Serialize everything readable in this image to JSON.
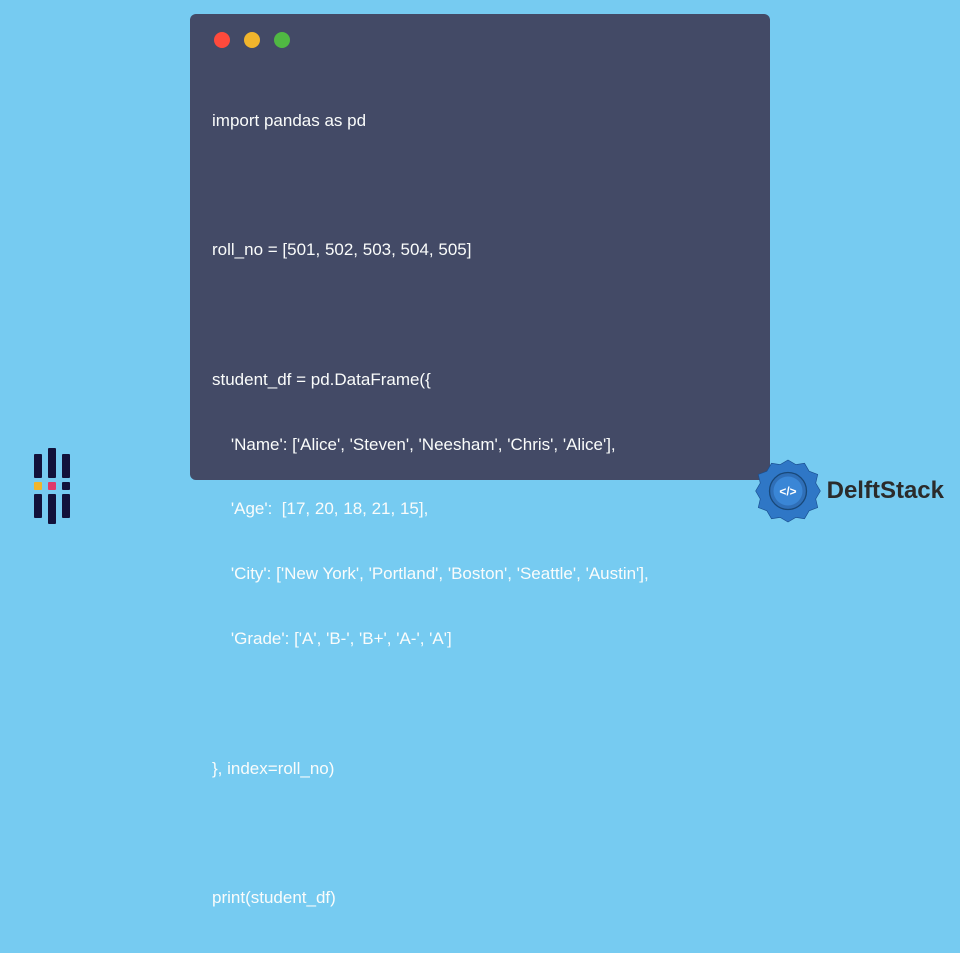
{
  "code": {
    "lines": [
      "import pandas as pd",
      "",
      "roll_no = [501, 502, 503, 504, 505]",
      "",
      "student_df = pd.DataFrame({",
      "    'Name': ['Alice', 'Steven', 'Neesham', 'Chris', 'Alice'],",
      "    'Age':  [17, 20, 18, 21, 15],",
      "    'City': ['New York', 'Portland', 'Boston', 'Seattle', 'Austin'],",
      "    'Grade': ['A', 'B-', 'B+', 'A-', 'A']",
      "",
      "}, index=roll_no)",
      "",
      "print(student_df)"
    ]
  },
  "brand": {
    "name": "DelftStack"
  },
  "window": {
    "buttons": [
      "close",
      "minimize",
      "maximize"
    ]
  }
}
